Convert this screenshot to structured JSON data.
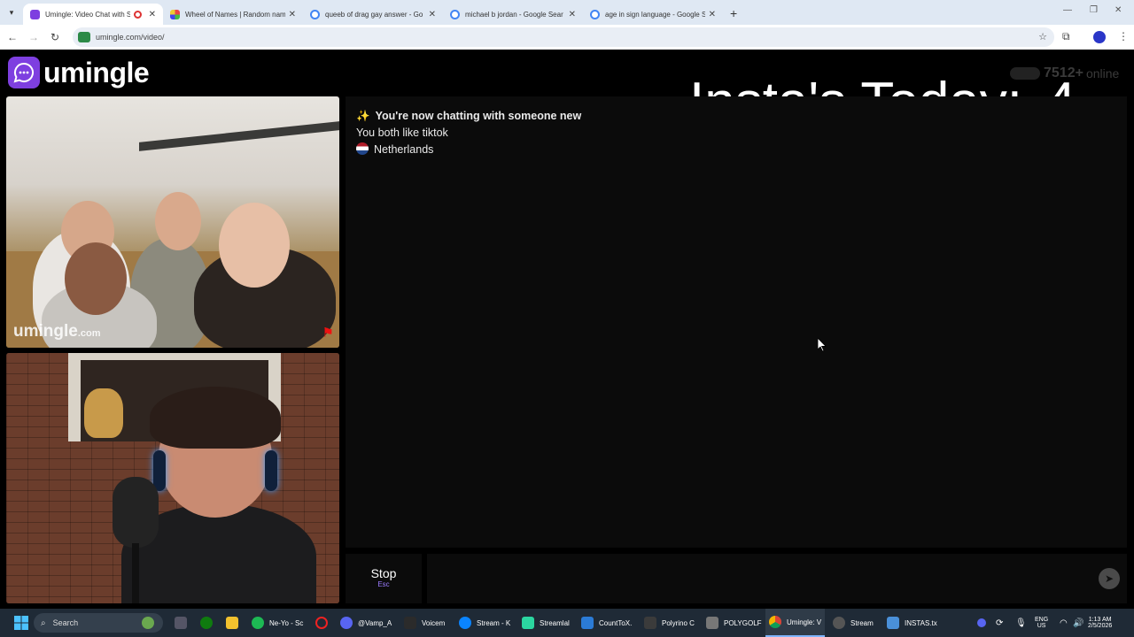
{
  "browser": {
    "tabs": [
      {
        "title": "Umingle: Video Chat with S",
        "active": true,
        "recording": true,
        "favicon_color": "#7e3fe0"
      },
      {
        "title": "Wheel of Names | Random nam",
        "active": false,
        "favicon_color": "#3a7be0"
      },
      {
        "title": "queeb of drag gay answer - Go",
        "active": false,
        "favicon_color": "#4285f4"
      },
      {
        "title": "michael b jordan - Google Sear",
        "active": false,
        "favicon_color": "#4285f4"
      },
      {
        "title": "age in sign language - Google S",
        "active": false,
        "favicon_color": "#4285f4"
      }
    ],
    "url": "umingle.com/video/"
  },
  "site": {
    "logo_text": "umingle",
    "online_count": "7512+",
    "online_label": "online",
    "overlay_label": "Insta's Today:",
    "overlay_count": "4",
    "watermark": "umingle",
    "watermark_suffix": ".com"
  },
  "chat": {
    "messages": [
      {
        "text": "You're now chatting with someone new",
        "bold": true,
        "icon": "sparkles-icon"
      },
      {
        "text": "You both like tiktok",
        "bold": false
      },
      {
        "text": "Netherlands",
        "bold": false,
        "icon": "netherlands-flag-icon"
      }
    ]
  },
  "controls": {
    "stop_label": "Stop",
    "stop_hint": "Esc",
    "send_icon": "send-icon"
  },
  "taskbar": {
    "search_label": "Search",
    "apps": [
      {
        "label": "Ne-Yo - Sc",
        "color": "#1db954"
      },
      {
        "label": "@Vamp_A",
        "color": "#5865f2"
      },
      {
        "label": "Voicem",
        "color": "#2b2b2b"
      },
      {
        "label": "Stream - K",
        "color": "#0a84ff"
      },
      {
        "label": "Streamlal",
        "color": "#2bd6a0"
      },
      {
        "label": "CountToX.",
        "color": "#2b7bd6"
      },
      {
        "label": "Polyrino C",
        "color": "#3b3b3b"
      },
      {
        "label": "POLYGOLF",
        "color": "#777"
      },
      {
        "label": "Umingle: V",
        "color": "#4285f4"
      },
      {
        "label": "Stream",
        "color": "#555"
      },
      {
        "label": "INSTAS.tx",
        "color": "#4a90d9"
      }
    ],
    "lang_top": "ENG",
    "lang_bottom": "US",
    "time": "1:13 AM",
    "date": "2/5/2026"
  }
}
